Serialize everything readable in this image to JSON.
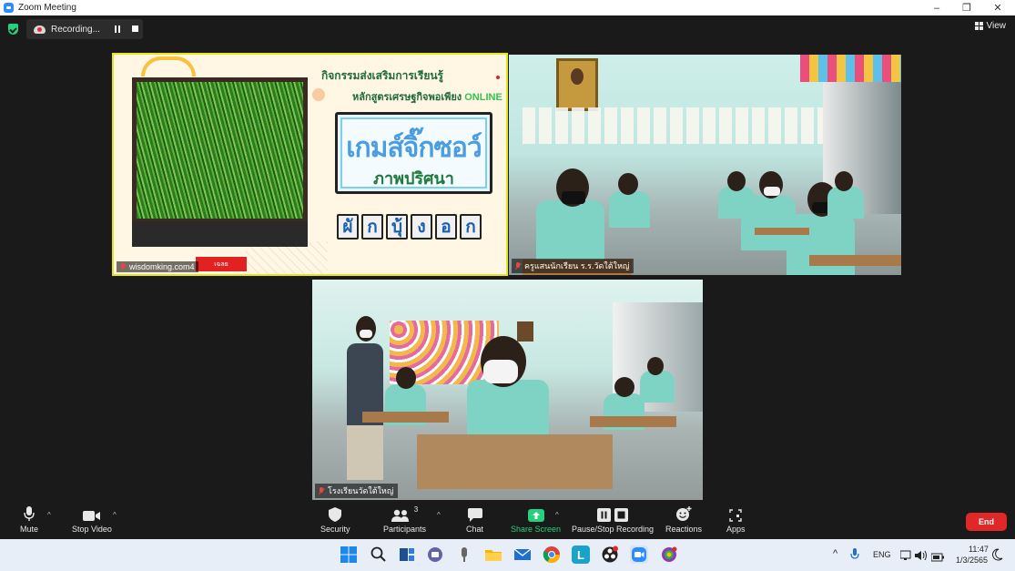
{
  "window": {
    "title": "Zoom Meeting",
    "controls": {
      "minimize": "–",
      "maximize": "❐",
      "close": "✕"
    }
  },
  "recording": {
    "label": "Recording..."
  },
  "view": {
    "label": "View"
  },
  "slide": {
    "heading1": "กิจกรรมส่งเสริมการเรียนรู้",
    "heading2_text": "หลักสูตรเศรษฐกิจพอเพียง",
    "heading2_highlight": "ONLINE",
    "title": "เกมส์จิ๊กซอว์",
    "subtitle": "ภาพปริศนา",
    "letters": [
      "ผั",
      "ก",
      "บุ้",
      "ง",
      "อ",
      "ก"
    ],
    "red_button": "เฉลย"
  },
  "tiles": {
    "slide_name": "wisdomking.com4",
    "class1_name": "ครูแสนนักเรียน ร.ร.วัดใต้ใหญ่",
    "class2_name": "โรงเรียนวัดใต้ใหญ่"
  },
  "toolbar": {
    "mute": "Mute",
    "stop_video": "Stop Video",
    "security": "Security",
    "participants": "Participants",
    "participants_count": "3",
    "chat": "Chat",
    "share_screen": "Share Screen",
    "pause_stop_recording": "Pause/Stop Recording",
    "reactions": "Reactions",
    "apps": "Apps",
    "end": "End"
  },
  "taskbar": {
    "language": "ENG",
    "time": "11:47",
    "date": "1/3/2565"
  },
  "colors": {
    "share_green": "#26d07c",
    "end_red": "#e02828",
    "slide_border": "#e6e61a"
  }
}
